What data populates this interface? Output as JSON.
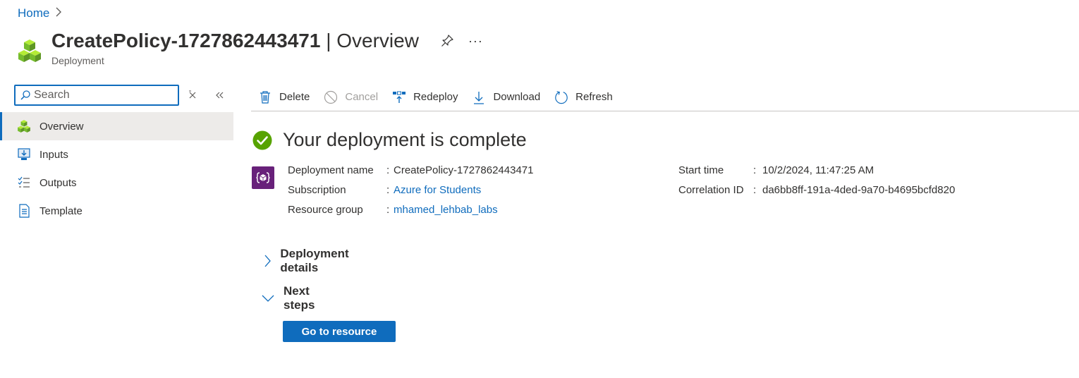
{
  "breadcrumb": {
    "home": "Home"
  },
  "header": {
    "title_name": "CreatePolicy-1727862443471",
    "title_section": "| Overview",
    "subtitle": "Deployment"
  },
  "sidebar": {
    "search_placeholder": "Search",
    "items": [
      {
        "label": "Overview",
        "icon": "cubes-icon",
        "active": true
      },
      {
        "label": "Inputs",
        "icon": "inputs-icon"
      },
      {
        "label": "Outputs",
        "icon": "outputs-icon"
      },
      {
        "label": "Template",
        "icon": "template-icon"
      }
    ]
  },
  "toolbar": {
    "delete": "Delete",
    "cancel": "Cancel",
    "redeploy": "Redeploy",
    "download": "Download",
    "refresh": "Refresh"
  },
  "status": {
    "message": "Your deployment is complete",
    "color": "#57a300"
  },
  "details": {
    "deployment_name_label": "Deployment name",
    "deployment_name": "CreatePolicy-1727862443471",
    "subscription_label": "Subscription",
    "subscription": "Azure for Students",
    "resource_group_label": "Resource group",
    "resource_group": "mhamed_lehbab_labs",
    "start_time_label": "Start time",
    "start_time": "10/2/2024, 11:47:25 AM",
    "correlation_label": "Correlation ID",
    "correlation_id": "da6bb8ff-191a-4ded-9a70-b4695bcfd820",
    "separator": ":"
  },
  "sections": {
    "deployment_details": "Deployment details",
    "next_steps": "Next steps"
  },
  "actions": {
    "go_to_resource": "Go to resource"
  },
  "colors": {
    "accent": "#0f6cbd",
    "template_purple": "#68217a"
  }
}
